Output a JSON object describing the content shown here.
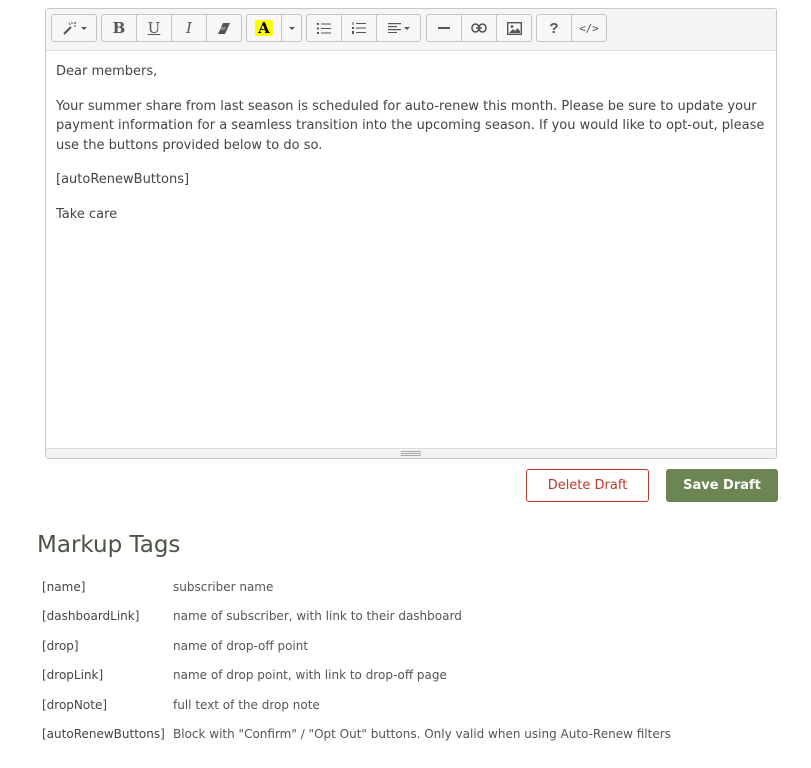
{
  "toolbar": {
    "groups": [
      [
        "magic-wand-icon"
      ],
      [
        "bold-icon",
        "underline-icon",
        "italic-icon",
        "eraser-icon"
      ],
      [
        "font-color-icon"
      ],
      [
        "bullet-list-icon",
        "numbered-list-icon",
        "align-icon"
      ],
      [
        "horizontal-rule-icon",
        "link-icon",
        "image-icon"
      ],
      [
        "help-icon",
        "code-view-icon"
      ]
    ],
    "bold_glyph": "B",
    "underline_glyph": "U",
    "italic_glyph": "I",
    "font_color_glyph": "A",
    "help_glyph": "?",
    "code_glyph": "</>",
    "font_color_swatch": "#ffff00"
  },
  "editor": {
    "paragraphs": [
      "Dear members,",
      "Your summer share from last season is scheduled for auto-renew this month. Please be sure to update your payment information for a seamless transition into the upcoming season. If you would like to opt-out, please use the buttons provided below to do so.",
      "[autoRenewButtons]",
      "Take care"
    ]
  },
  "actions": {
    "delete_label": "Delete Draft",
    "save_label": "Save Draft",
    "delete_color": "#c0392b",
    "save_color": "#6b8553"
  },
  "markup": {
    "title": "Markup Tags",
    "tags": [
      {
        "tag": "[name]",
        "description": "subscriber name"
      },
      {
        "tag": "[dashboardLink]",
        "description": "name of subscriber, with link to their dashboard"
      },
      {
        "tag": "[drop]",
        "description": "name of drop-off point"
      },
      {
        "tag": "[dropLink]",
        "description": "name of drop point, with link to drop-off page"
      },
      {
        "tag": "[dropNote]",
        "description": "full text of the drop note"
      },
      {
        "tag": "[autoRenewButtons]",
        "description": "Block with \"Confirm\" / \"Opt Out\" buttons. Only valid when using Auto-Renew filters"
      }
    ]
  }
}
